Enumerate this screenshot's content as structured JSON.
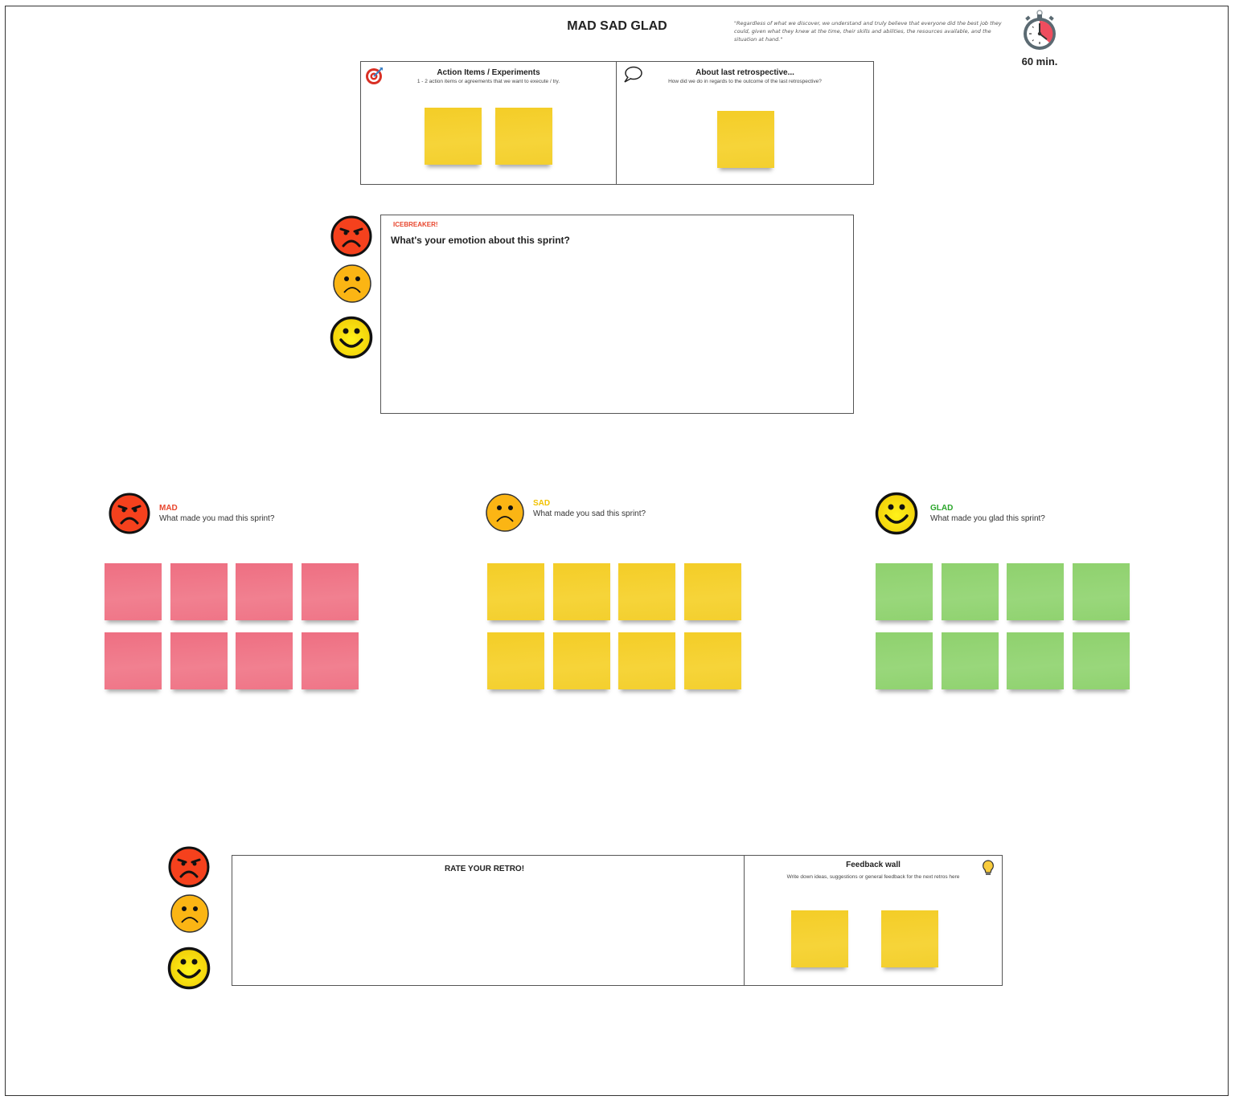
{
  "header": {
    "title": "MAD SAD GLAD",
    "prime_directive": "\"Regardless of what we discover, we understand and truly believe that everyone did the best job they could, given what they knew at the time, their skills and abilities, the resources available, and the situation at hand.\"",
    "timer_icon": "stopwatch-icon",
    "timer_label": "60 min."
  },
  "action_items": {
    "icon": "target-icon",
    "title": "Action Items / Experiments",
    "subtitle": "1 - 2 action items or agreements that we want to execute / try.",
    "notes": [
      {
        "color": "yellow"
      },
      {
        "color": "yellow"
      }
    ]
  },
  "last_retro": {
    "icon": "speech-bubble-icon",
    "title": "About last retrospective...",
    "subtitle": "How did we do in regards to the outcome of the last retrospective?",
    "notes": [
      {
        "color": "yellow"
      }
    ]
  },
  "icebreaker": {
    "tag": "ICEBREAKER!",
    "question": "What's your emotion about this sprint?",
    "faces": [
      "angry-face-icon",
      "sad-face-icon",
      "happy-face-icon"
    ]
  },
  "columns": [
    {
      "key": "mad",
      "label": "MAD",
      "question": "What made you mad this sprint?",
      "label_color": "#e8452c",
      "note_color": "pink",
      "note_count": 8,
      "icon": "angry-face-icon"
    },
    {
      "key": "sad",
      "label": "SAD",
      "question": "What made you sad this sprint?",
      "label_color": "#f2c200",
      "note_color": "yellow",
      "note_count": 8,
      "icon": "sad-face-icon"
    },
    {
      "key": "glad",
      "label": "GLAD",
      "question": "What made you glad this sprint?",
      "label_color": "#2aa52a",
      "note_color": "green",
      "note_count": 8,
      "icon": "happy-face-icon"
    }
  ],
  "rate_retro": {
    "title": "RATE YOUR RETRO!",
    "faces": [
      "angry-face-icon",
      "sad-face-icon",
      "happy-face-icon"
    ]
  },
  "feedback_wall": {
    "title": "Feedback wall",
    "subtitle": "Write down ideas, suggestions or general feedback for the next retros here",
    "icon": "lightbulb-icon",
    "notes": [
      {
        "color": "yellow"
      },
      {
        "color": "yellow"
      }
    ]
  },
  "colors": {
    "mad_face": "#f5411d",
    "sad_face": "#fbb514",
    "glad_face": "#f9e20e",
    "note_yellow": "#f5d030",
    "note_pink": "#f07587",
    "note_green": "#93d374"
  }
}
